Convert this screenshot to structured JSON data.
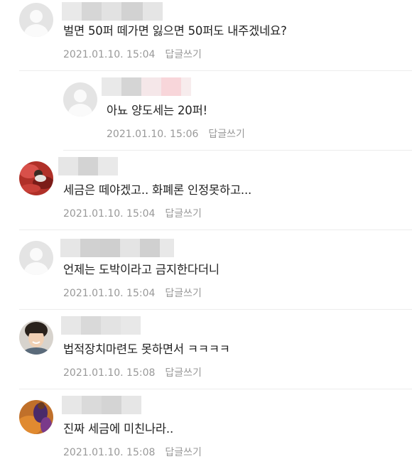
{
  "comments": [
    {
      "text": "벌면 50퍼 떼가면 잃으면 50퍼도 내주겠네요?",
      "date": "2021.01.10. 15:04",
      "reply": "답글쓰기"
    },
    {
      "text": "아뇨 양도세는 20퍼!",
      "date": "2021.01.10. 15:06",
      "reply": "답글쓰기"
    },
    {
      "text": "세금은 떼야겠고.. 화폐론 인정못하고...",
      "date": "2021.01.10. 15:04",
      "reply": "답글쓰기"
    },
    {
      "text": "언제는 도박이라고 금지한다더니",
      "date": "2021.01.10. 15:04",
      "reply": "답글쓰기"
    },
    {
      "text": "법적장치마련도 못하면서 ㅋㅋㅋㅋ",
      "date": "2021.01.10. 15:08",
      "reply": "답글쓰기"
    },
    {
      "text": "진짜 세금에 미친나라..",
      "date": "2021.01.10. 15:08",
      "reply": "답글쓰기"
    }
  ]
}
